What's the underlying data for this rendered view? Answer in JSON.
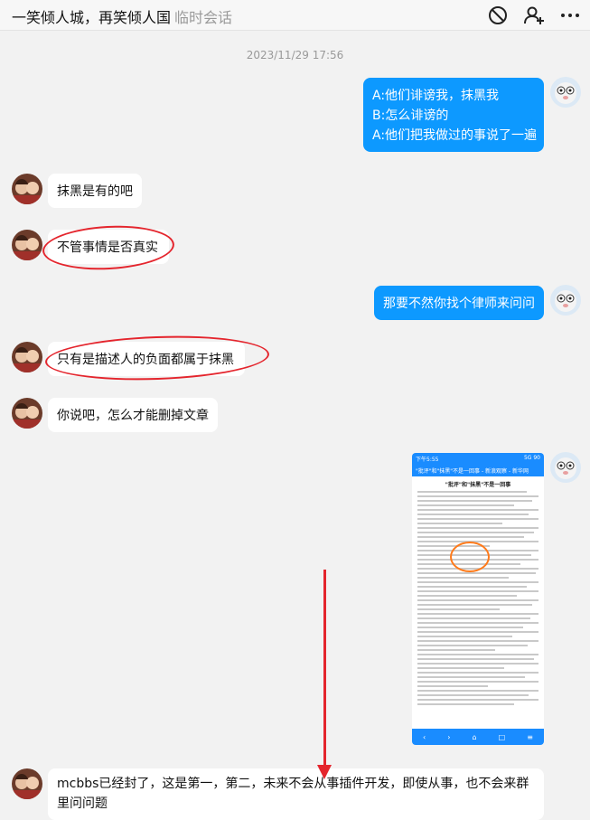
{
  "header": {
    "title": "一笑倾人城，再笑倾人国",
    "subtitle": "临时会话"
  },
  "timestamp": "2023/11/29 17:56",
  "messages": [
    {
      "side": "out",
      "lines": [
        "A:他们诽谤我，抹黑我",
        "B:怎么诽谤的",
        "A:他们把我做过的事说了一遍"
      ]
    },
    {
      "side": "in",
      "lines": [
        "抹黑是有的吧"
      ]
    },
    {
      "side": "in",
      "lines": [
        "不管事情是否真实"
      ]
    },
    {
      "side": "out",
      "lines": [
        "那要不然你找个律师来问问"
      ]
    },
    {
      "side": "in",
      "lines": [
        "只有是描述人的负面都属于抹黑"
      ]
    },
    {
      "side": "in",
      "lines": [
        "你说吧，怎么才能删掉文章"
      ]
    },
    {
      "side": "in",
      "lines": [
        "mcbbs已经封了，这是第一，第二，未来不会从事插件开发，即使从事，也不会来群",
        "里问问题"
      ]
    }
  ],
  "screenshot_image": {
    "status_left": "下午5:55",
    "status_right": "5G 90",
    "search_text": "\"批评\"和\"抹黑\"不是一回事 - 新浪观察 - 新华网",
    "headline": "\"批评\"和\"抹黑\"不是一回事"
  },
  "colors": {
    "out_bubble": "#0d99ff",
    "in_bubble": "#ffffff",
    "annotation": "#e4252d"
  },
  "icons": {
    "block": "block-icon",
    "add_user": "add-user-icon",
    "more": "more-icon"
  }
}
